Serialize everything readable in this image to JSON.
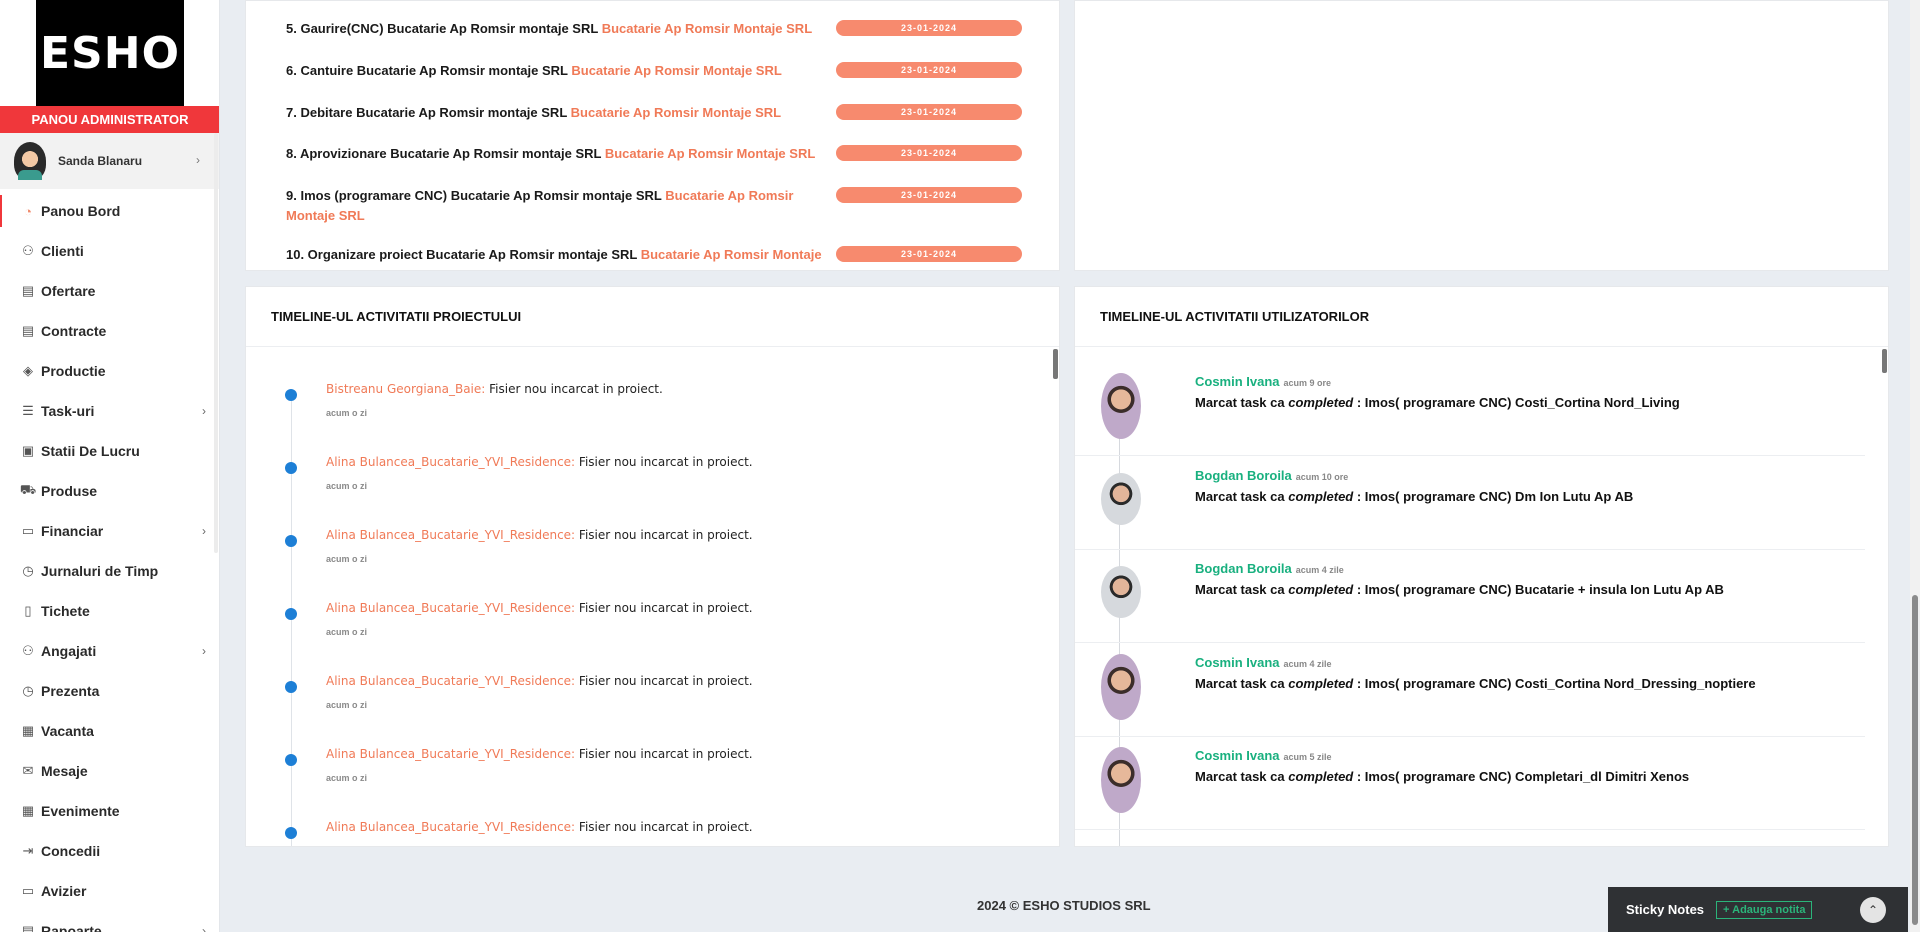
{
  "brand": {
    "logo": "ESHO",
    "admin_banner": "PANOU ADMINISTRATOR"
  },
  "user": {
    "name": "Sanda Blanaru",
    "chevron": "›"
  },
  "nav": [
    {
      "label": "Panou Bord",
      "icon": "dashboard-icon",
      "glyph": "◔",
      "active": true
    },
    {
      "label": "Clienti",
      "icon": "users-icon",
      "glyph": "⚇"
    },
    {
      "label": "Ofertare",
      "icon": "document-icon",
      "glyph": "▤"
    },
    {
      "label": "Contracte",
      "icon": "contract-icon",
      "glyph": "▤"
    },
    {
      "label": "Productie",
      "icon": "layers-icon",
      "glyph": "◈"
    },
    {
      "label": "Task-uri",
      "icon": "tasks-icon",
      "glyph": "☰",
      "chevron": "›"
    },
    {
      "label": "Statii De Lucru",
      "icon": "workstation-icon",
      "glyph": "▣"
    },
    {
      "label": "Produse",
      "icon": "cart-icon",
      "glyph": "⛟"
    },
    {
      "label": "Financiar",
      "icon": "money-icon",
      "glyph": "▭",
      "chevron": "›"
    },
    {
      "label": "Jurnaluri de Timp",
      "icon": "clock-icon",
      "glyph": "◷"
    },
    {
      "label": "Tichete",
      "icon": "ticket-icon",
      "glyph": "▯"
    },
    {
      "label": "Angajati",
      "icon": "employee-icon",
      "glyph": "⚇",
      "chevron": "›"
    },
    {
      "label": "Prezenta",
      "icon": "attendance-icon",
      "glyph": "◷"
    },
    {
      "label": "Vacanta",
      "icon": "calendar-icon",
      "glyph": "▦"
    },
    {
      "label": "Mesaje",
      "icon": "mail-icon",
      "glyph": "✉"
    },
    {
      "label": "Evenimente",
      "icon": "events-icon",
      "glyph": "▦"
    },
    {
      "label": "Concedii",
      "icon": "leave-icon",
      "glyph": "⇥"
    },
    {
      "label": "Avizier",
      "icon": "board-icon",
      "glyph": "▭"
    },
    {
      "label": "Rapoarte",
      "icon": "reports-icon",
      "glyph": "▤",
      "chevron": "›"
    }
  ],
  "tasks": [
    {
      "text": "5. Gaurire(CNC) Bucatarie Ap Romsir montaje SRL ",
      "link": "Bucatarie Ap Romsir Montaje SRL",
      "date": "23-01-2024"
    },
    {
      "text": "6. Cantuire Bucatarie Ap Romsir montaje SRL ",
      "link": "Bucatarie Ap Romsir Montaje SRL",
      "date": "23-01-2024"
    },
    {
      "text": "7. Debitare Bucatarie Ap Romsir montaje SRL ",
      "link": "Bucatarie Ap Romsir Montaje SRL",
      "date": "23-01-2024"
    },
    {
      "text": "8. Aprovizionare Bucatarie Ap Romsir montaje SRL ",
      "link": "Bucatarie Ap Romsir Montaje SRL",
      "date": "23-01-2024"
    },
    {
      "text": "9. Imos (programare CNC) Bucatarie Ap Romsir montaje SRL ",
      "link": "Bucatarie Ap Romsir Montaje SRL",
      "date": "23-01-2024"
    },
    {
      "text": "10. Organizare proiect Bucatarie Ap Romsir montaje SRL ",
      "link": "Bucatarie Ap Romsir Montaje SRL",
      "date": "23-01-2024"
    }
  ],
  "project_timeline": {
    "title": "TIMELINE-UL ACTIVITATII PROIECTULUI",
    "items": [
      {
        "who": "Bistreanu Georgiana_Baie:",
        "msg": " Fisier nou incarcat in proiect.",
        "time": "acum o zi"
      },
      {
        "who": "Alina Bulancea_Bucatarie_YVI_Residence:",
        "msg": " Fisier nou incarcat in proiect.",
        "time": "acum o zi"
      },
      {
        "who": "Alina Bulancea_Bucatarie_YVI_Residence:",
        "msg": " Fisier nou incarcat in proiect.",
        "time": "acum o zi"
      },
      {
        "who": "Alina Bulancea_Bucatarie_YVI_Residence:",
        "msg": " Fisier nou incarcat in proiect.",
        "time": "acum o zi"
      },
      {
        "who": "Alina Bulancea_Bucatarie_YVI_Residence:",
        "msg": " Fisier nou incarcat in proiect.",
        "time": "acum o zi"
      },
      {
        "who": "Alina Bulancea_Bucatarie_YVI_Residence:",
        "msg": " Fisier nou incarcat in proiect.",
        "time": "acum o zi"
      },
      {
        "who": "Alina Bulancea_Bucatarie_YVI_Residence:",
        "msg": " Fisier nou incarcat in proiect.",
        "time": ""
      }
    ]
  },
  "user_timeline": {
    "title": "TIMELINE-UL ACTIVITATII UTILIZATORILOR",
    "items": [
      {
        "name": "Cosmin Ivana",
        "ago": "acum 9 ore",
        "prefix": "Marcat task ca ",
        "status": "completed",
        "detail": " : Imos( programare CNC) Costi_Cortina Nord_Living",
        "avatar": "a"
      },
      {
        "name": "Bogdan Boroila",
        "ago": "acum 10 ore",
        "prefix": "Marcat task ca ",
        "status": "completed",
        "detail": " : Imos( programare CNC) Dm Ion Lutu Ap AB",
        "avatar": "b"
      },
      {
        "name": "Bogdan Boroila",
        "ago": "acum 4 zile",
        "prefix": "Marcat task ca ",
        "status": "completed",
        "detail": " : Imos( programare CNC) Bucatarie + insula Ion Lutu Ap AB",
        "avatar": "b"
      },
      {
        "name": "Cosmin Ivana",
        "ago": "acum 4 zile",
        "prefix": "Marcat task ca ",
        "status": "completed",
        "detail": " : Imos( programare CNC) Costi_Cortina Nord_Dressing_noptiere",
        "avatar": "a"
      },
      {
        "name": "Cosmin Ivana",
        "ago": "acum 5 zile",
        "prefix": "Marcat task ca ",
        "status": "completed",
        "detail": " : Imos( programare CNC) Completari_dl Dimitri Xenos",
        "avatar": "a"
      }
    ]
  },
  "footer": {
    "text": "2024 © ESHO STUDIOS SRL"
  },
  "sticky": {
    "title": "Sticky Notes",
    "add_label": "+ Adauga notita",
    "up_glyph": "⌃"
  }
}
